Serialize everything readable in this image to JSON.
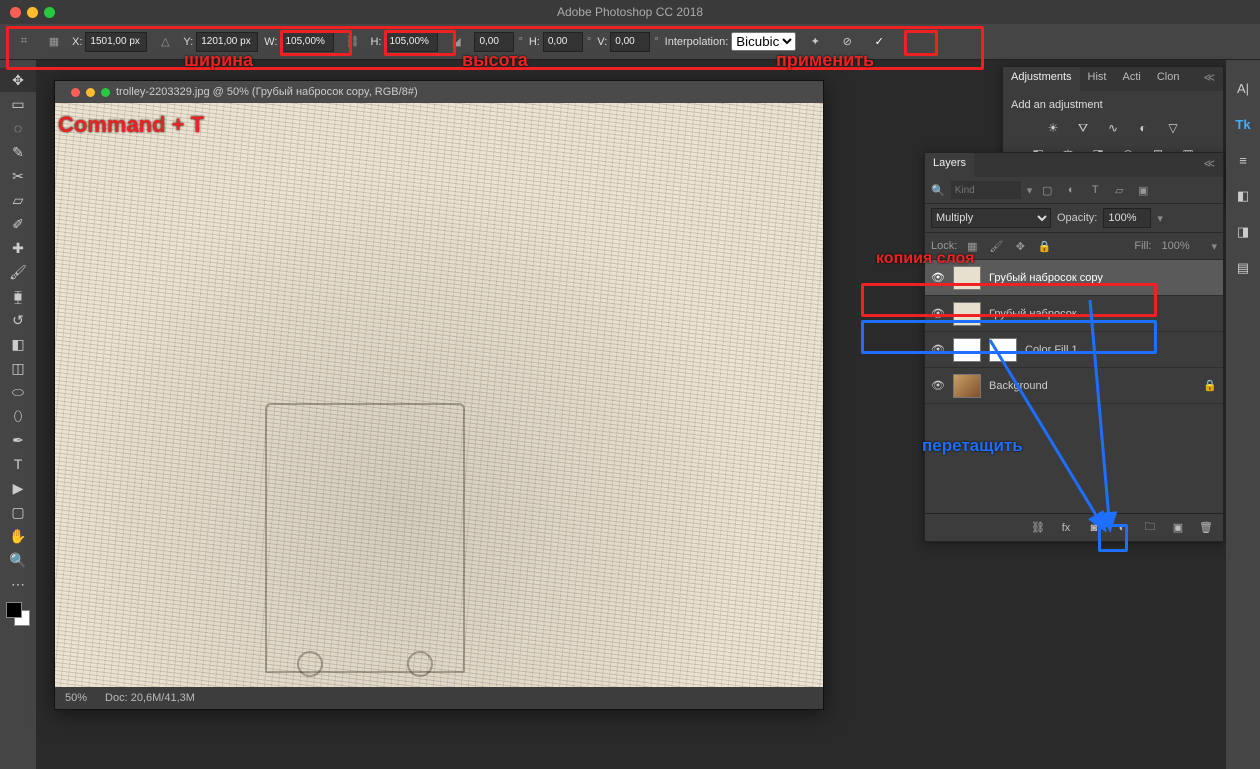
{
  "app": {
    "title": "Adobe Photoshop CC 2018"
  },
  "options_bar": {
    "x_label": "X:",
    "x_value": "1501,00 px",
    "y_label": "Y:",
    "y_value": "1201,00 px",
    "w_label": "W:",
    "w_value": "105,00%",
    "h_label": "H:",
    "h_value": "105,00%",
    "rot_value": "0,00",
    "hskew_label": "H:",
    "hskew_value": "0,00",
    "vskew_label": "V:",
    "vskew_value": "0,00",
    "interp_label": "Interpolation:",
    "interp_value": "Bicubic"
  },
  "document": {
    "title": "trolley-2203329.jpg @ 50% (Грубый набросок copy, RGB/8#)",
    "zoom": "50%",
    "docsize": "Doc: 20,6M/41,3M"
  },
  "adjustments": {
    "tabs": [
      "Adjustments",
      "Hist",
      "Acti",
      "Clon"
    ],
    "header": "Add an adjustment"
  },
  "layers": {
    "tab": "Layers",
    "kind_placeholder": "Kind",
    "blend_mode": "Multiply",
    "opacity_label": "Opacity:",
    "opacity_value": "100%",
    "lock_label": "Lock:",
    "fill_label": "Fill:",
    "fill_value": "100%",
    "items": [
      {
        "name": "Грубый набросок copy",
        "selected": true,
        "thumb": "sketch"
      },
      {
        "name": "Грубый набросок",
        "selected": false,
        "thumb": "sketch"
      },
      {
        "name": "Color Fill 1",
        "selected": false,
        "thumb": "white",
        "mask": true
      },
      {
        "name": "Background",
        "selected": false,
        "thumb": "bg",
        "locked": true
      }
    ]
  },
  "annotations": {
    "command_t": "Command + T",
    "width": "ширина",
    "height": "высота",
    "apply": "применить",
    "layer_copy": "копиия слоя",
    "drag": "перетащить"
  }
}
